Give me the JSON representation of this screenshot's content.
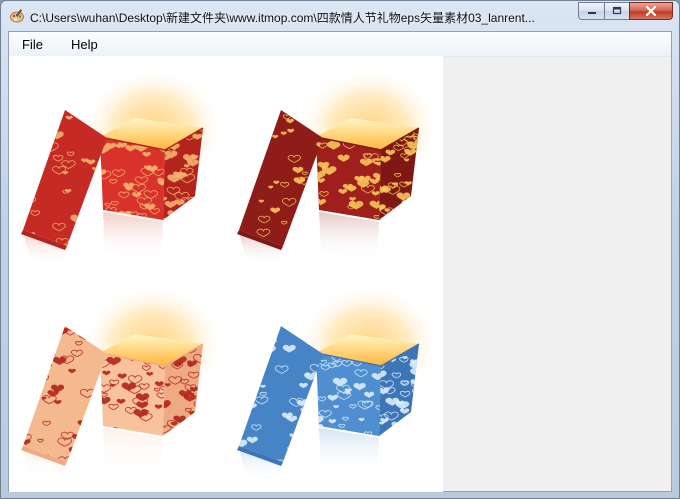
{
  "window": {
    "title": "C:\\Users\\wuhan\\Desktop\\新建文件夹\\www.itmop.com\\四款情人节礼物eps矢量素材03_lanrent...",
    "app_icon": "paint-palette-icon",
    "controls": {
      "minimize": "minimize-icon",
      "maximize": "maximize-icon",
      "close": "close-icon"
    }
  },
  "menu": {
    "items": [
      {
        "label": "File"
      },
      {
        "label": "Help"
      }
    ]
  },
  "canvas": {
    "background": "#ffffff",
    "images": [
      {
        "name": "gift-box-red",
        "box": "#d8322a",
        "box_dark": "#b3241e",
        "lid": "#c62a24",
        "hearts": "#f2b36b"
      },
      {
        "name": "gift-box-dark-red",
        "box": "#9e1f1b",
        "box_dark": "#7f1714",
        "lid": "#8e1c18",
        "hearts": "#f6c55a"
      },
      {
        "name": "gift-box-peach",
        "box": "#f7c29c",
        "box_dark": "#eeab82",
        "lid": "#f4b98f",
        "hearts": "#b3241e"
      },
      {
        "name": "gift-box-blue",
        "box": "#4f8fd0",
        "box_dark": "#3c76b6",
        "lid": "#4784c6",
        "hearts": "#dcecfb"
      }
    ]
  },
  "colors": {
    "glow": "#ffd27a",
    "inside": "#ffb63a",
    "client_bg": "#f0f0f0"
  }
}
